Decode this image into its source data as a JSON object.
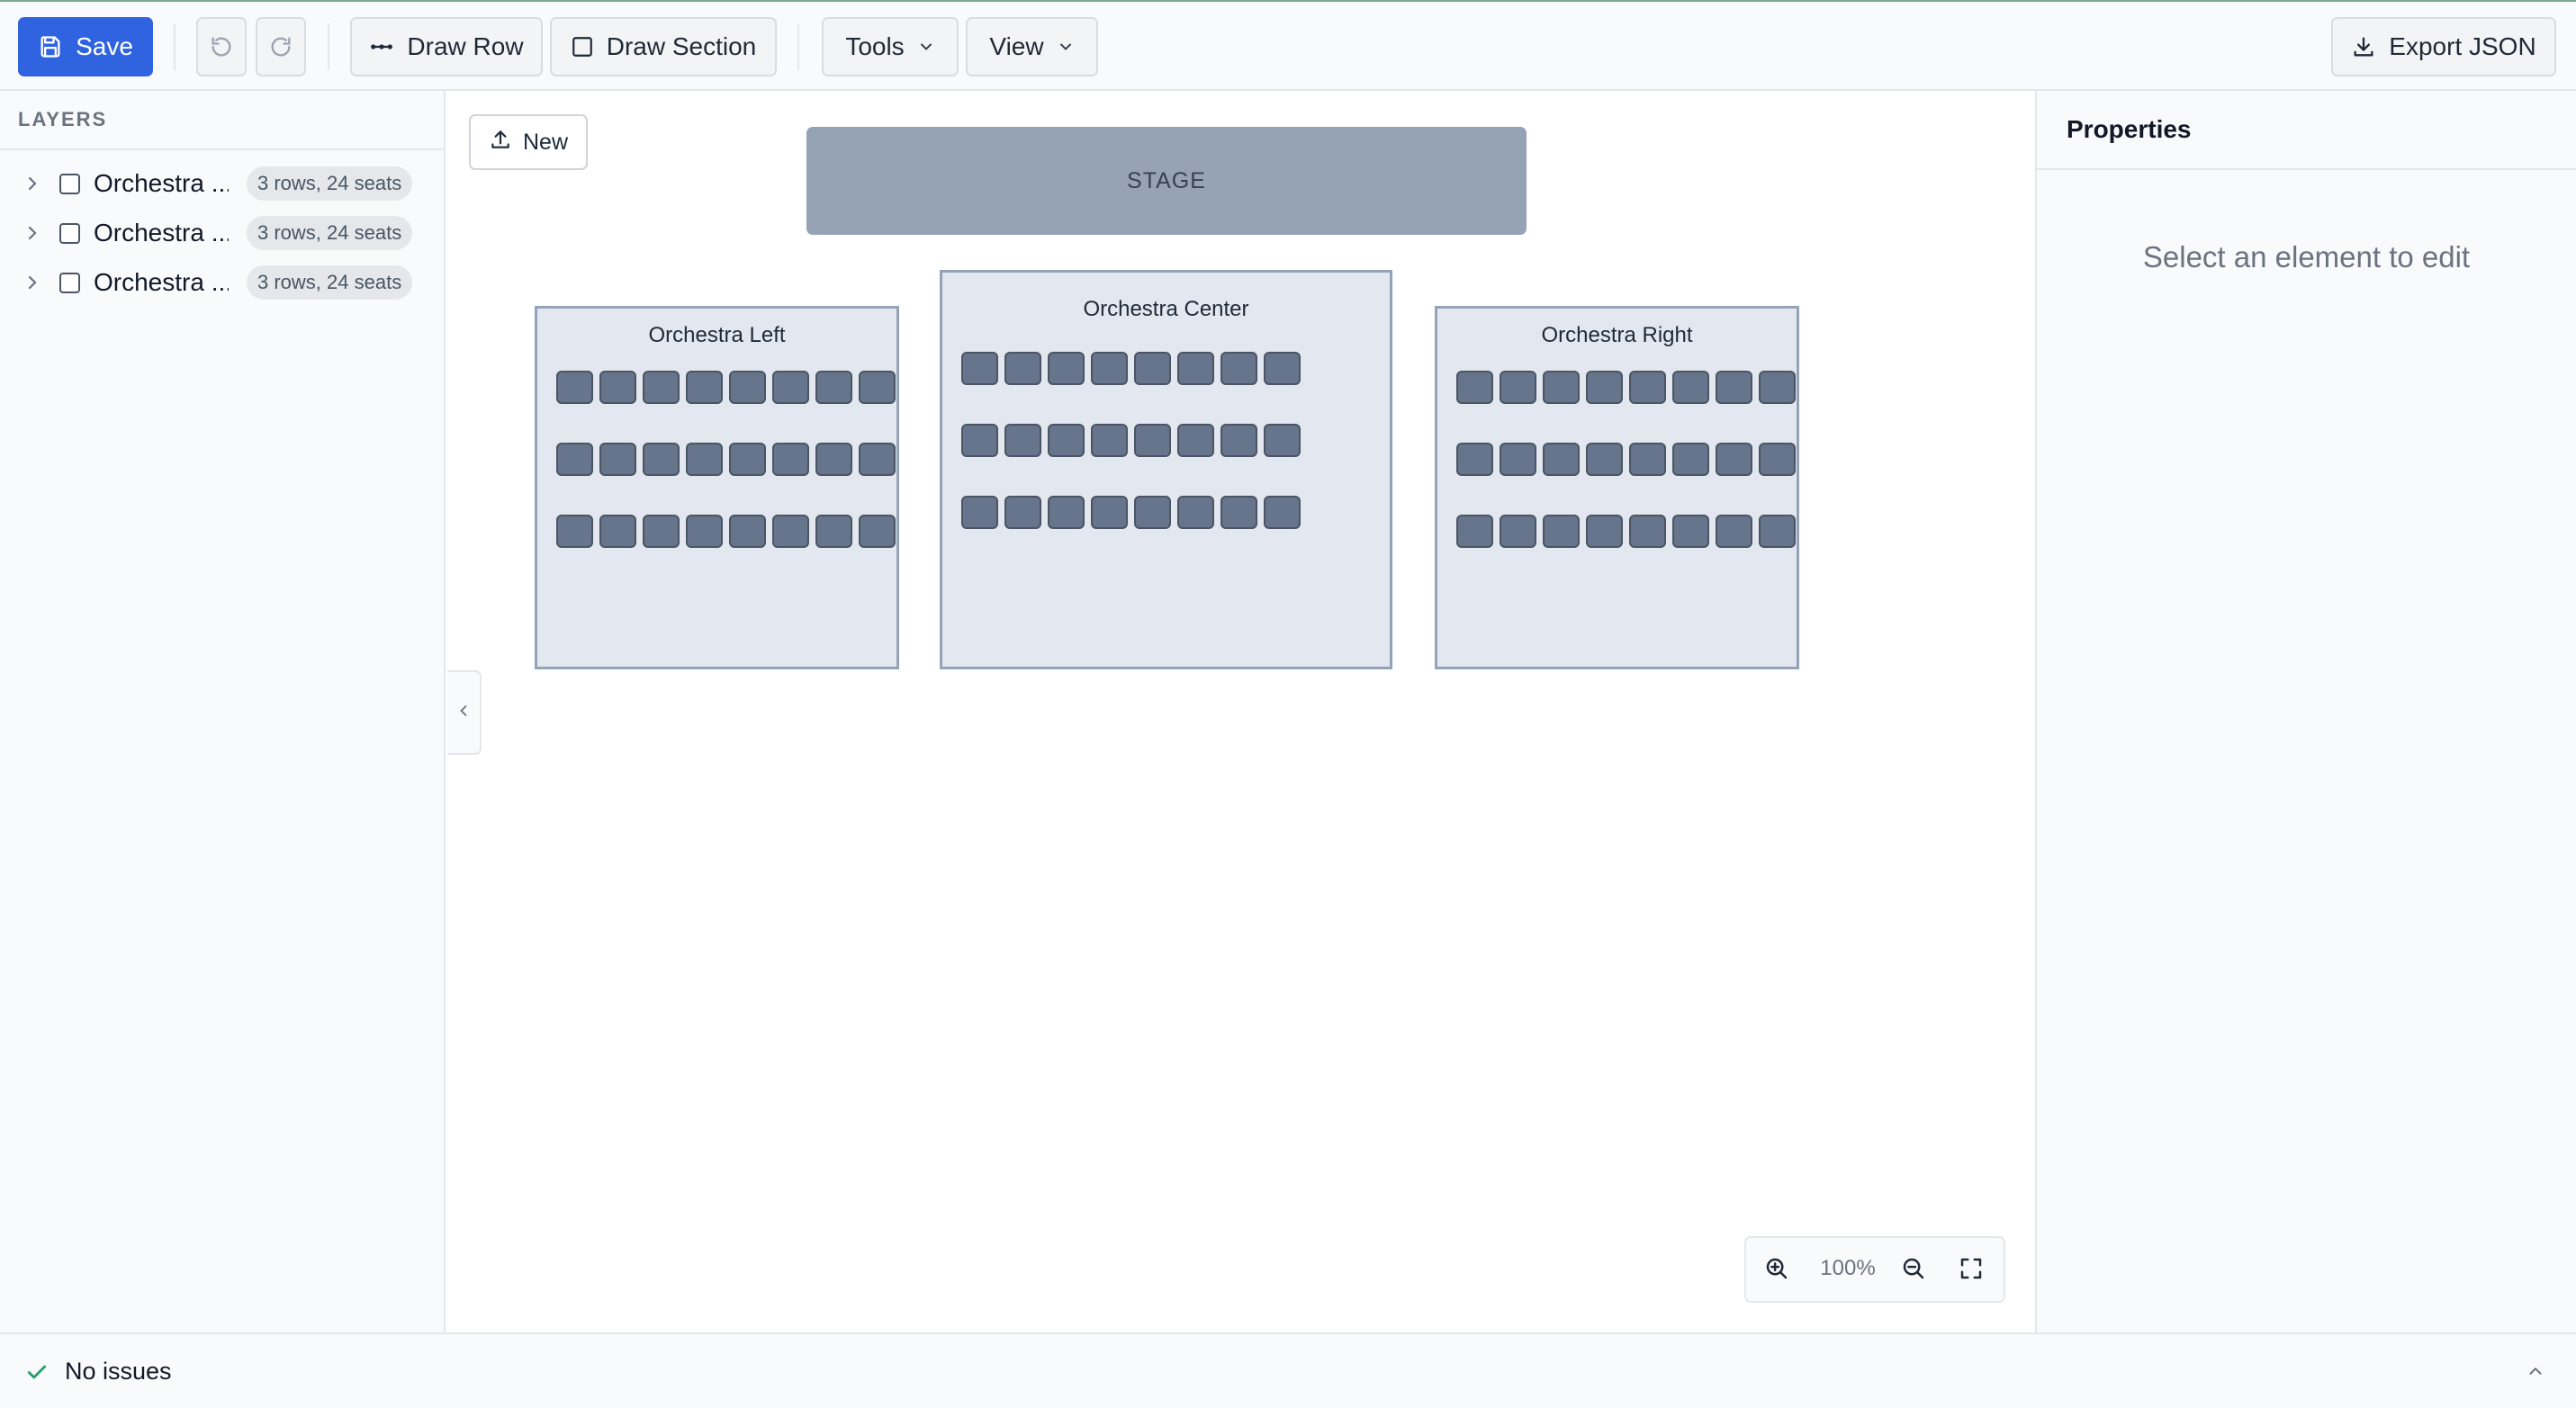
{
  "toolbar": {
    "save_label": "Save",
    "draw_row_label": "Draw Row",
    "draw_section_label": "Draw Section",
    "tools_label": "Tools",
    "view_label": "View",
    "export_label": "Export JSON",
    "icons": [
      "save-icon",
      "undo-icon",
      "redo-icon",
      "row-dots-icon",
      "square-icon",
      "chevron-down-icon",
      "download-icon"
    ]
  },
  "layers": {
    "heading": "LAYERS",
    "items": [
      {
        "label": "Orchestra ...",
        "badge": "3 rows, 24 seats"
      },
      {
        "label": "Orchestra ...",
        "badge": "3 rows, 24 seats"
      },
      {
        "label": "Orchestra ...",
        "badge": "3 rows, 24 seats"
      }
    ]
  },
  "canvas": {
    "new_label": "New",
    "stage_label": "STAGE",
    "sections": [
      {
        "name": "Orchestra Left",
        "rows": 3,
        "seats_per_row": 8
      },
      {
        "name": "Orchestra Center",
        "rows": 3,
        "seats_per_row": 8
      },
      {
        "name": "Orchestra Right",
        "rows": 3,
        "seats_per_row": 8
      }
    ],
    "zoom_level": "100%"
  },
  "properties": {
    "heading": "Properties",
    "empty_message": "Select an element to edit"
  },
  "status": {
    "message": "No issues"
  },
  "colors": {
    "primary": "#2f63e0",
    "seat_fill": "#66758b",
    "section_fill": "#e3e7ef",
    "stage_fill": "#96a3b6",
    "status_ok": "#22a06b"
  }
}
